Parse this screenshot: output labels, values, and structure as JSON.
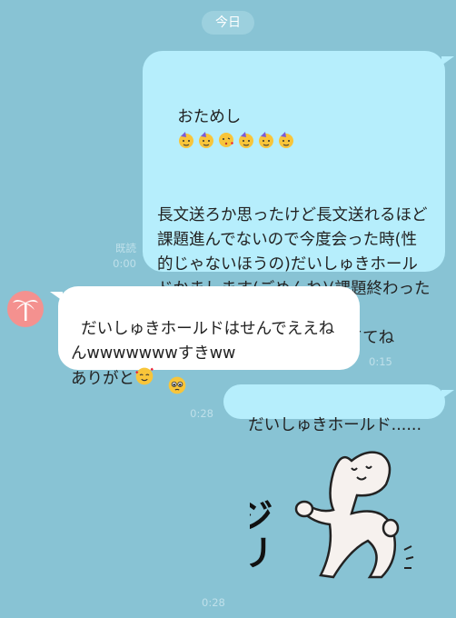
{
  "date_chip": "今日",
  "messages": [
    {
      "line1_text": "おためし",
      "line1_emojis": [
        "partying-face-emoji",
        "partying-face-emoji",
        "kissing-heart-emoji",
        "partying-face-emoji",
        "partying-face-emoji",
        "partying-face-emoji"
      ],
      "body": "長文送ろか思ったけど長文送れるほど課題進んでないので今度会った時(性的じゃないほうの)だいしゅきホールドかまします(ごめんね)(課題終わったらおじさん構文で送るわ)\n誕プレは期待しないで待っててね",
      "trailing_emoji": "pleading-face-emoji",
      "read": "既読",
      "time": "0:00"
    },
    {
      "text": "だいしゅきホールドはせんでええねんwwwwwwwすきww\nありがと",
      "trailing_emoji": "smiling-hearts-emoji",
      "time": "0:15"
    },
    {
      "text": "だいしゅきホールド......",
      "time": "0:28"
    },
    {
      "sticker_text": "ジリ…",
      "sticker_name": "cat-sticker",
      "time": "0:28"
    }
  ],
  "avatar_icon": "palm-tree-icon",
  "colors": {
    "background": "#88c3d4",
    "sent_bubble": "#b6eefc",
    "received_bubble": "#ffffff",
    "avatar_bg": "#f4918f"
  }
}
